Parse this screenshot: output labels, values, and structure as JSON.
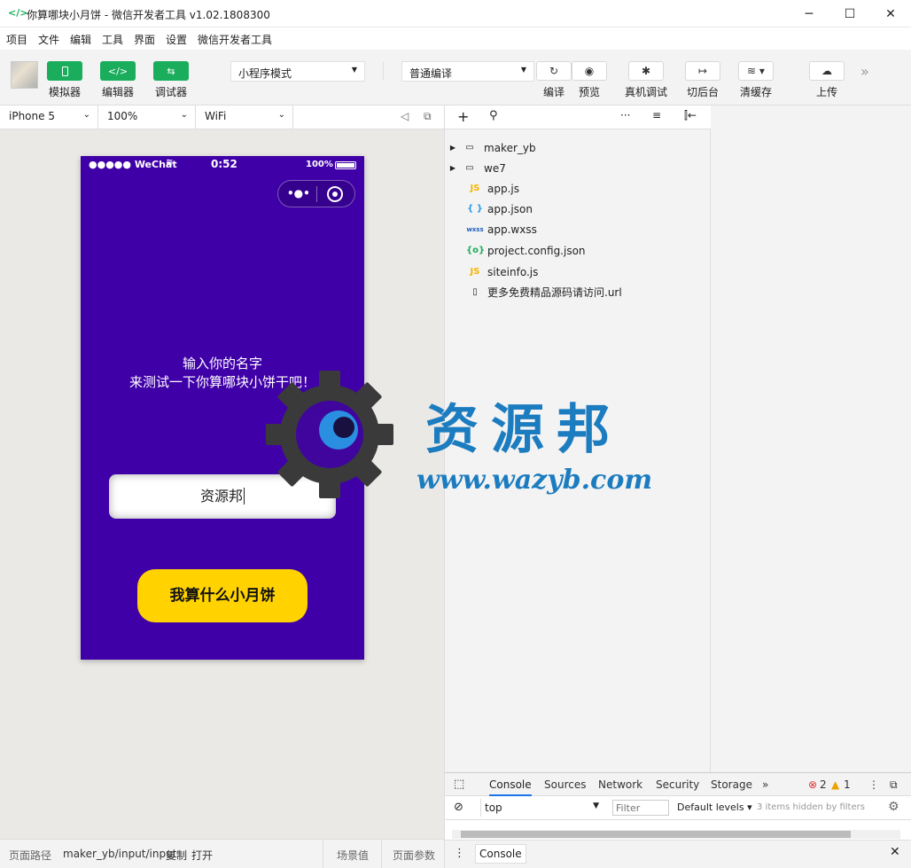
{
  "window": {
    "title": "你算哪块小月饼 - 微信开发者工具 v1.02.1808300",
    "minimize": "─",
    "maximize": "☐",
    "close": "✕"
  },
  "menu": [
    "项目",
    "文件",
    "编辑",
    "工具",
    "界面",
    "设置",
    "微信开发者工具"
  ],
  "toolbar": {
    "simulator": "模拟器",
    "editor": "编辑器",
    "debugger": "调试器",
    "mode": "小程序模式",
    "compile_mode": "普通编译",
    "compile": "编译",
    "preview": "预览",
    "remote_debug": "真机调试",
    "background": "切后台",
    "clear_cache": "清缓存",
    "upload": "上传"
  },
  "device": {
    "model": "iPhone 5",
    "zoom": "100%",
    "network": "WiFi"
  },
  "phone": {
    "carrier": "●●●●● WeChat",
    "time": "0:52",
    "battery": "100%",
    "prompt_line1": "输入你的名字",
    "prompt_line2": "来测试一下你算哪块小饼干吧！",
    "input_value": "资源邦",
    "button": "我算什么小月饼"
  },
  "files": [
    {
      "name": "maker_yb",
      "type": "folder"
    },
    {
      "name": "we7",
      "type": "folder"
    },
    {
      "name": "app.js",
      "type": "js"
    },
    {
      "name": "app.json",
      "type": "json"
    },
    {
      "name": "app.wxss",
      "type": "wxss"
    },
    {
      "name": "project.config.json",
      "type": "config"
    },
    {
      "name": "siteinfo.js",
      "type": "js"
    },
    {
      "name": "更多免费精品源码请访问.url",
      "type": "file"
    }
  ],
  "devtools": {
    "tabs": [
      "Console",
      "Sources",
      "Network",
      "Security",
      "Storage"
    ],
    "errors": "2",
    "warnings": "1",
    "context": "top",
    "filter_placeholder": "Filter",
    "levels": "Default levels",
    "hidden": "3 items hidden by filters",
    "drawer_tab": "Console"
  },
  "footer": {
    "path_label": "页面路径",
    "path": "maker_yb/input/input",
    "copy": "复制",
    "open": "打开",
    "scene": "场景值",
    "params": "页面参数"
  },
  "watermark": {
    "text": "资源邦",
    "url": "www.wazyb.com"
  },
  "colors": {
    "accent": "#1aad5c",
    "phone_bg": "#4000a8",
    "button": "#ffd200"
  }
}
